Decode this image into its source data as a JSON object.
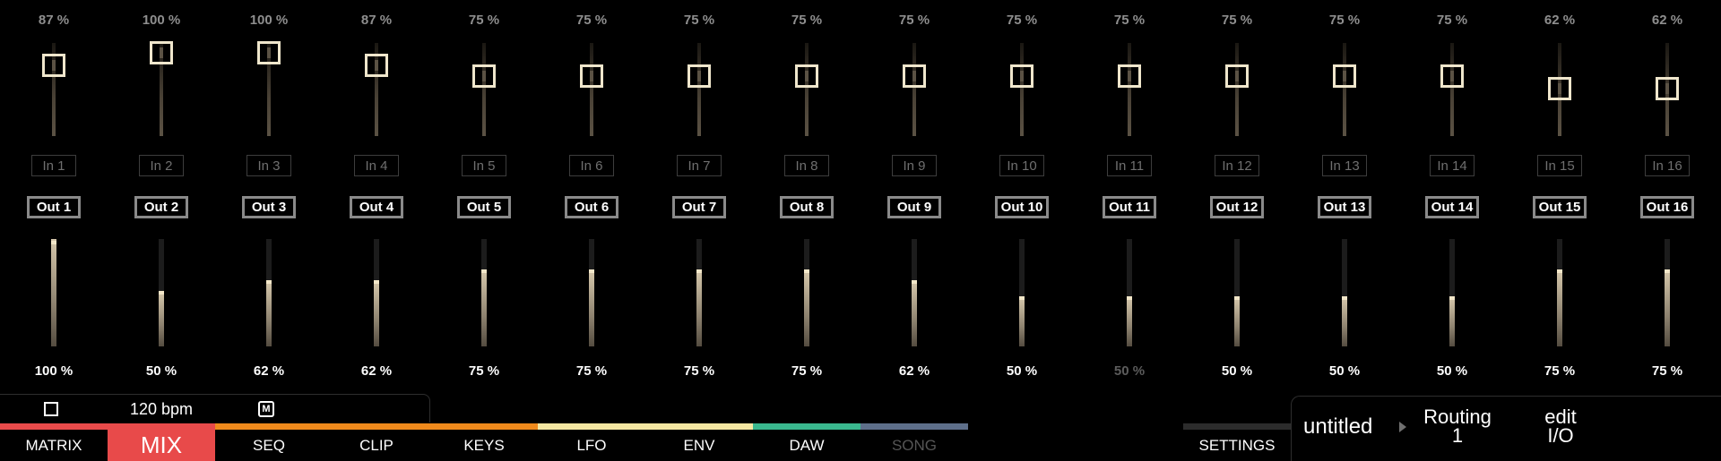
{
  "channels": [
    {
      "gain": "87 %",
      "gain_value": 0.87,
      "input": "In 1",
      "output": "Out 1",
      "volume": "100 %",
      "volume_value": 1.0,
      "peak": 0.98,
      "dim": false
    },
    {
      "gain": "100 %",
      "gain_value": 1.0,
      "input": "In 2",
      "output": "Out 2",
      "volume": "50 %",
      "volume_value": 0.5,
      "peak": 0.52,
      "dim": false
    },
    {
      "gain": "100 %",
      "gain_value": 1.0,
      "input": "In 3",
      "output": "Out 3",
      "volume": "62 %",
      "volume_value": 0.6,
      "peak": 0.62,
      "dim": false
    },
    {
      "gain": "87 %",
      "gain_value": 0.87,
      "input": "In 4",
      "output": "Out 4",
      "volume": "62 %",
      "volume_value": 0.6,
      "peak": 0.62,
      "dim": false
    },
    {
      "gain": "75 %",
      "gain_value": 0.75,
      "input": "In 5",
      "output": "Out 5",
      "volume": "75 %",
      "volume_value": 0.7,
      "peak": 0.72,
      "dim": false
    },
    {
      "gain": "75 %",
      "gain_value": 0.75,
      "input": "In 6",
      "output": "Out 6",
      "volume": "75 %",
      "volume_value": 0.7,
      "peak": 0.72,
      "dim": false
    },
    {
      "gain": "75 %",
      "gain_value": 0.75,
      "input": "In 7",
      "output": "Out 7",
      "volume": "75 %",
      "volume_value": 0.7,
      "peak": 0.72,
      "dim": false
    },
    {
      "gain": "75 %",
      "gain_value": 0.75,
      "input": "In 8",
      "output": "Out 8",
      "volume": "75 %",
      "volume_value": 0.7,
      "peak": 0.72,
      "dim": false
    },
    {
      "gain": "75 %",
      "gain_value": 0.75,
      "input": "In 9",
      "output": "Out 9",
      "volume": "62 %",
      "volume_value": 0.6,
      "peak": 0.62,
      "dim": false
    },
    {
      "gain": "75 %",
      "gain_value": 0.75,
      "input": "In 10",
      "output": "Out 10",
      "volume": "50 %",
      "volume_value": 0.45,
      "peak": 0.47,
      "dim": false
    },
    {
      "gain": "75 %",
      "gain_value": 0.75,
      "input": "In 11",
      "output": "Out 11",
      "volume": "50 %",
      "volume_value": 0.45,
      "peak": 0.47,
      "dim": true
    },
    {
      "gain": "75 %",
      "gain_value": 0.75,
      "input": "In 12",
      "output": "Out 12",
      "volume": "50 %",
      "volume_value": 0.45,
      "peak": 0.47,
      "dim": false
    },
    {
      "gain": "75 %",
      "gain_value": 0.75,
      "input": "In 13",
      "output": "Out 13",
      "volume": "50 %",
      "volume_value": 0.45,
      "peak": 0.47,
      "dim": false
    },
    {
      "gain": "75 %",
      "gain_value": 0.75,
      "input": "In 14",
      "output": "Out 14",
      "volume": "50 %",
      "volume_value": 0.45,
      "peak": 0.47,
      "dim": false
    },
    {
      "gain": "62 %",
      "gain_value": 0.62,
      "input": "In 15",
      "output": "Out 15",
      "volume": "75 %",
      "volume_value": 0.7,
      "peak": 0.72,
      "dim": false
    },
    {
      "gain": "62 %",
      "gain_value": 0.62,
      "input": "In 16",
      "output": "Out 16",
      "volume": "75 %",
      "volume_value": 0.7,
      "peak": 0.72,
      "dim": false
    }
  ],
  "transport": {
    "stop_icon": "square-icon",
    "bpm": "120 bpm",
    "metronome_label": "M"
  },
  "tabs": [
    {
      "label": "MATRIX",
      "color": "#e84a4a",
      "active": false,
      "disabled": false
    },
    {
      "label": "MIX",
      "color": "#e84a4a",
      "active": true,
      "disabled": false
    },
    {
      "label": "SEQ",
      "color": "#f08a1c",
      "active": false,
      "disabled": false
    },
    {
      "label": "CLIP",
      "color": "#f08a1c",
      "active": false,
      "disabled": false
    },
    {
      "label": "KEYS",
      "color": "#f08a1c",
      "active": false,
      "disabled": false
    },
    {
      "label": "LFO",
      "color": "#f4e7a2",
      "active": false,
      "disabled": false
    },
    {
      "label": "ENV",
      "color": "#f4e7a2",
      "active": false,
      "disabled": false
    },
    {
      "label": "DAW",
      "color": "#3ab88e",
      "active": false,
      "disabled": false
    },
    {
      "label": "SONG",
      "color": "#5e6f8a",
      "active": false,
      "disabled": true
    }
  ],
  "settings": {
    "label": "SETTINGS"
  },
  "project": {
    "name": "untitled",
    "routing_line1": "Routing",
    "routing_line2": "1",
    "edit_line1": "edit",
    "edit_line2": "I/O"
  },
  "colors": {
    "background": "#000000",
    "mix_active": "#e84a4a",
    "fader_thumb": "#efe6cc",
    "meter_peak": "#f2e6c8"
  }
}
